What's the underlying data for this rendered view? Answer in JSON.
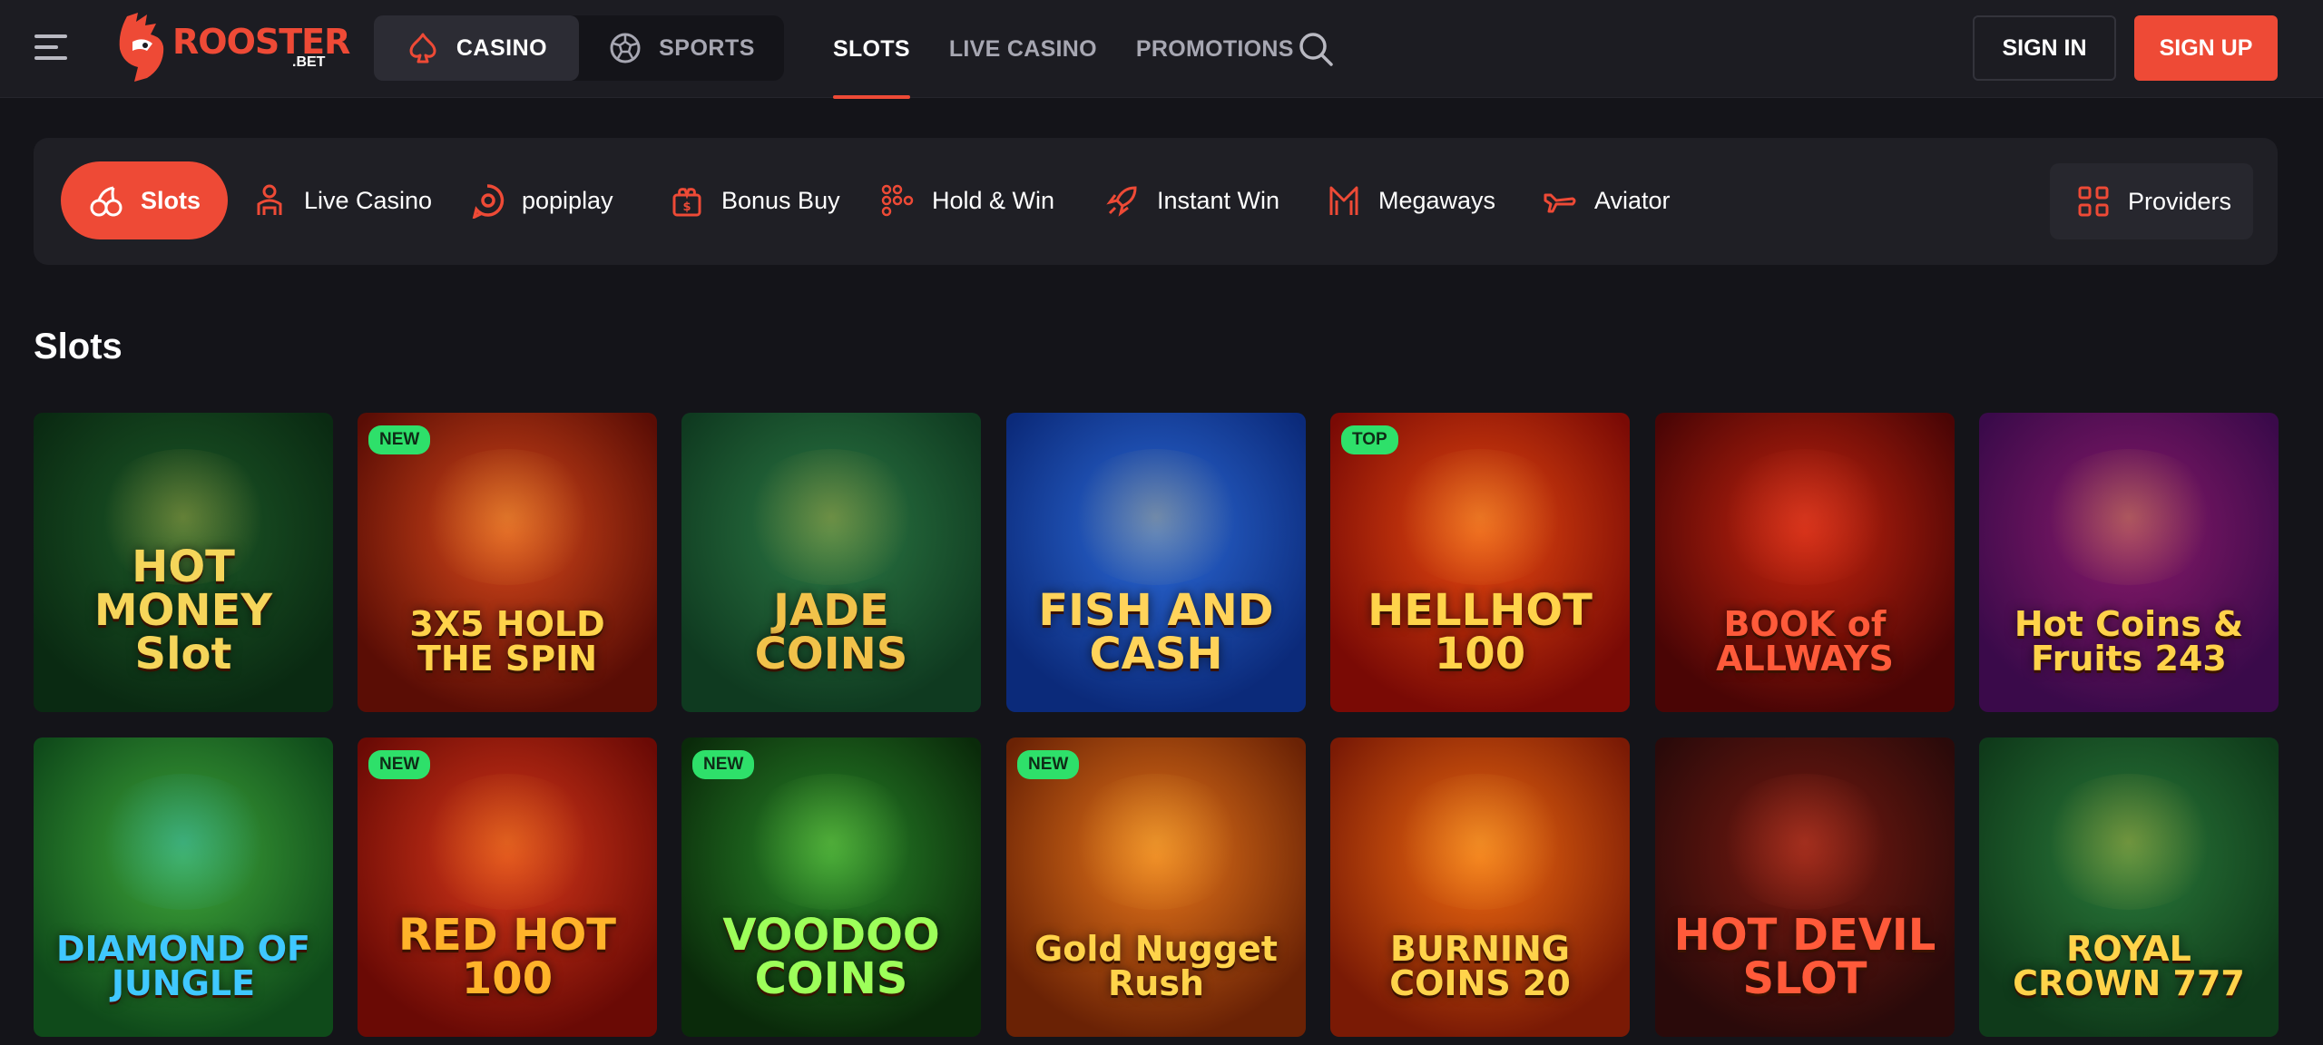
{
  "header": {
    "logo_text": "ROOSTER",
    "logo_sub": ".BET",
    "segment": [
      {
        "label": "CASINO",
        "icon": "spade-icon",
        "active": true
      },
      {
        "label": "SPORTS",
        "icon": "soccer-ball-icon",
        "active": false
      }
    ],
    "nav": [
      {
        "label": "SLOTS",
        "active": true
      },
      {
        "label": "LIVE CASINO",
        "active": false
      },
      {
        "label": "PROMOTIONS",
        "active": false
      }
    ],
    "sign_in": "SIGN IN",
    "sign_up": "SIGN UP"
  },
  "categories": [
    {
      "label": "Slots",
      "icon": "cherries-icon",
      "active": true
    },
    {
      "label": "Live Casino",
      "icon": "dealer-icon",
      "active": false
    },
    {
      "label": "popiplay",
      "icon": "popiplay-icon",
      "active": false
    },
    {
      "label": "Bonus Buy",
      "icon": "gift-icon",
      "active": false
    },
    {
      "label": "Hold & Win",
      "icon": "dots-icon",
      "active": false
    },
    {
      "label": "Instant Win",
      "icon": "rocket-icon",
      "active": false
    },
    {
      "label": "Megaways",
      "icon": "megaways-icon",
      "active": false
    },
    {
      "label": "Aviator",
      "icon": "plane-icon",
      "active": false
    }
  ],
  "providers_label": "Providers",
  "section_title": "Slots",
  "games": [
    {
      "title": "HOT MONEY Slot",
      "badge": "",
      "colors": [
        "#0a2a12",
        "#1d5a28"
      ],
      "text_color": "#f5d55a"
    },
    {
      "title": "3X5 HOLD THE SPIN",
      "badge": "NEW",
      "colors": [
        "#5a0d05",
        "#d8481a"
      ],
      "text_color": "#ffd34a"
    },
    {
      "title": "JADE COINS",
      "badge": "",
      "colors": [
        "#0f3a20",
        "#2c7a45"
      ],
      "text_color": "#f1c24a"
    },
    {
      "title": "FISH AND CASH",
      "badge": "",
      "colors": [
        "#0b2a7a",
        "#2c6ad8"
      ],
      "text_color": "#ffd35a"
    },
    {
      "title": "HELLHOT 100",
      "badge": "TOP",
      "colors": [
        "#7a0a05",
        "#e84a10"
      ],
      "text_color": "#ffd34a"
    },
    {
      "title": "BOOK of ALLWAYS",
      "badge": "",
      "colors": [
        "#4a0505",
        "#c8240e"
      ],
      "text_color": "#ff5a3a"
    },
    {
      "title": "Hot Coins & Fruits 243",
      "badge": "",
      "colors": [
        "#3a0a4a",
        "#8a1a6a"
      ],
      "text_color": "#ffd34a"
    },
    {
      "title": "DIAMOND OF JUNGLE",
      "badge": "",
      "colors": [
        "#0f4a1a",
        "#3fa83a"
      ],
      "text_color": "#3fc8ff"
    },
    {
      "title": "RED HOT 100",
      "badge": "NEW",
      "colors": [
        "#6a0a05",
        "#d8381a"
      ],
      "text_color": "#ffb32a"
    },
    {
      "title": "VOODOO COINS",
      "badge": "NEW",
      "colors": [
        "#0a2a0a",
        "#2a8a2a"
      ],
      "text_color": "#9dff5a"
    },
    {
      "title": "Gold Nugget Rush",
      "badge": "NEW",
      "colors": [
        "#6a2205",
        "#e8761a"
      ],
      "text_color": "#ffd34a"
    },
    {
      "title": "BURNING COINS 20",
      "badge": "",
      "colors": [
        "#7a1a05",
        "#f06a10"
      ],
      "text_color": "#ffd34a"
    },
    {
      "title": "HOT DEVIL SLOT",
      "badge": "",
      "colors": [
        "#2a0a0a",
        "#7a1a10"
      ],
      "text_color": "#ff5a3a"
    },
    {
      "title": "ROYAL CROWN 777",
      "badge": "",
      "colors": [
        "#0f3a1a",
        "#2a7a3a"
      ],
      "text_color": "#ffd34a"
    }
  ]
}
